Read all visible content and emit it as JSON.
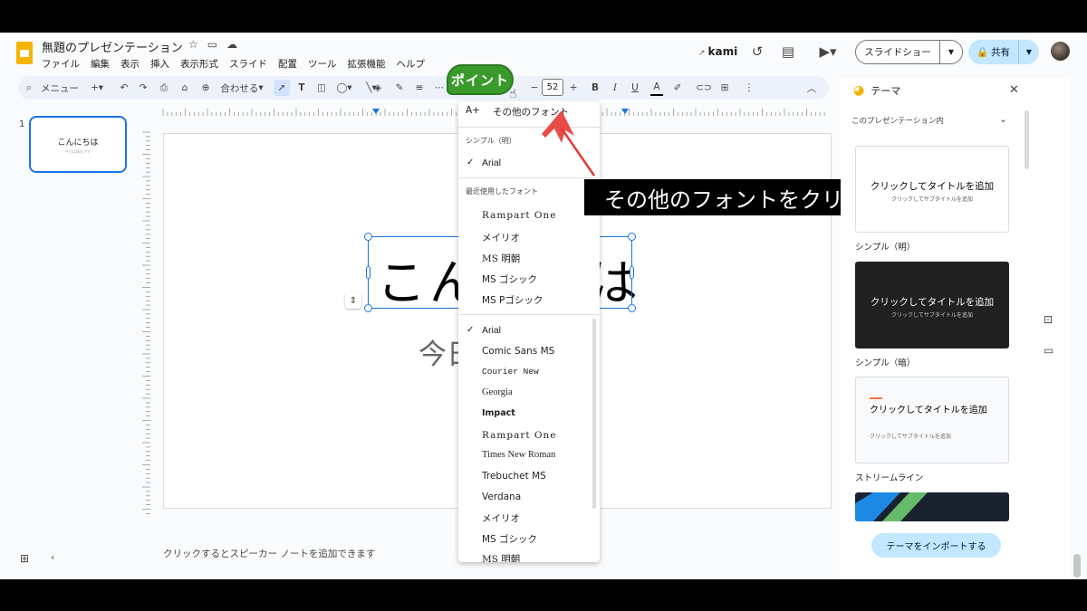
{
  "header": {
    "doc_title": "無題のプレゼンテーション",
    "menu": [
      "ファイル",
      "編集",
      "表示",
      "挿入",
      "表示形式",
      "スライド",
      "配置",
      "ツール",
      "拡張機能",
      "ヘルプ"
    ],
    "kami": "kami",
    "slideshow_label": "スライドショー",
    "share_label": "共有"
  },
  "toolbar": {
    "menu_label": "メニュー",
    "zoom_label": "合わせる",
    "font_size": "52"
  },
  "filmstrip": {
    "slide_number": "1",
    "thumb_title": "こんにちは",
    "thumb_subtitle": "今日は晴れです"
  },
  "slide": {
    "title_visible_start": "こん",
    "title_visible_end": "は",
    "subtitle_visible": "今日"
  },
  "notes_placeholder": "クリックするとスピーカー ノートを追加できます",
  "font_menu": {
    "more_fonts": "その他のフォント",
    "section_theme": "シンプル（明）",
    "theme_font": "Arial",
    "section_recent": "最近使用したフォント",
    "recent": [
      "Rampart One",
      "メイリオ",
      "MS 明朝",
      "MS ゴシック",
      "MS Pゴシック"
    ],
    "all": [
      "Arial",
      "Comic Sans MS",
      "Courier New",
      "Georgia",
      "Impact",
      "Rampart One",
      "Times New Roman",
      "Trebuchet MS",
      "Verdana",
      "メイリオ",
      "MS ゴシック",
      "MS 明朝"
    ]
  },
  "annotation": {
    "badge": "ポイント",
    "caption": "その他のフォントをクリック"
  },
  "theme_panel": {
    "title": "テーマ",
    "subtitle": "このプレゼンテーション内",
    "cards": [
      {
        "title": "クリックしてタイトルを追加",
        "subtitle": "クリックしてサブタイトルを追加",
        "label": "シンプル（明）"
      },
      {
        "title": "クリックしてタイトルを追加",
        "subtitle": "クリックしてサブタイトルを追加",
        "label": "シンプル（暗）"
      },
      {
        "title": "クリックしてタイトルを追加",
        "subtitle": "クリックしてサブタイトルを追加",
        "label": "ストリームライン"
      }
    ],
    "import_label": "テーマをインポートする"
  },
  "colors": {
    "accent": "#1a73e8",
    "share_bg": "#c2e7ff",
    "badge_green": "#3a9a2c",
    "arrow_red": "#e53935"
  }
}
